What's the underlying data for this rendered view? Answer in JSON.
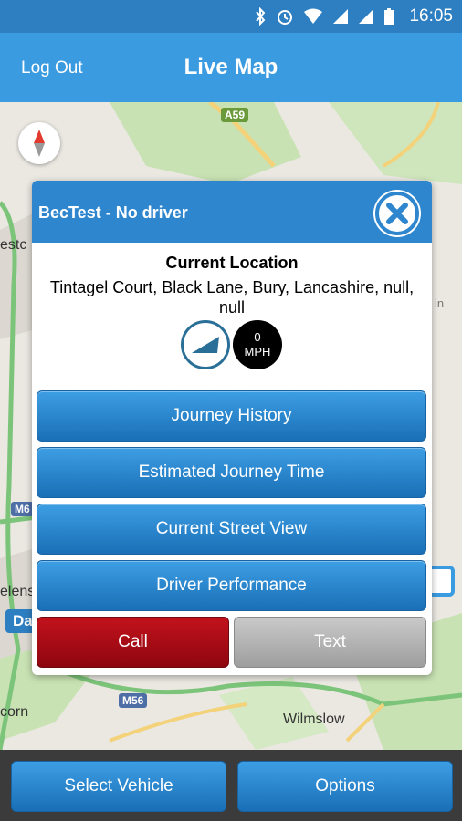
{
  "status_bar": {
    "time": "16:05"
  },
  "header": {
    "logout_label": "Log Out",
    "title": "Live Map"
  },
  "map": {
    "labels": {
      "town_top_left": "estc",
      "town_left_mid": "elens",
      "town_bottom_left": "corn",
      "town_bottom": "Wilmslow",
      "right_edge": "in"
    },
    "road_badges": {
      "a59": "A59",
      "m6": "M6",
      "m56": "M56"
    },
    "blue_tag": "Da"
  },
  "popup": {
    "title": "BecTest - No driver",
    "location_heading": "Current Location",
    "address": "Tintagel Court, Black Lane, Bury, Lancashire, null, null",
    "speed_value": "0",
    "speed_unit": "MPH",
    "buttons": {
      "journey_history": "Journey History",
      "estimated_journey_time": "Estimated Journey Time",
      "current_street_view": "Current Street View",
      "driver_performance": "Driver Performance",
      "call": "Call",
      "text": "Text"
    }
  },
  "bottom_bar": {
    "select_vehicle": "Select Vehicle",
    "options": "Options"
  },
  "colors": {
    "header": "#3b9be0",
    "status_bar": "#2e7fc2",
    "call": "#b00d16",
    "text_disabled": "#b0b0b0"
  }
}
